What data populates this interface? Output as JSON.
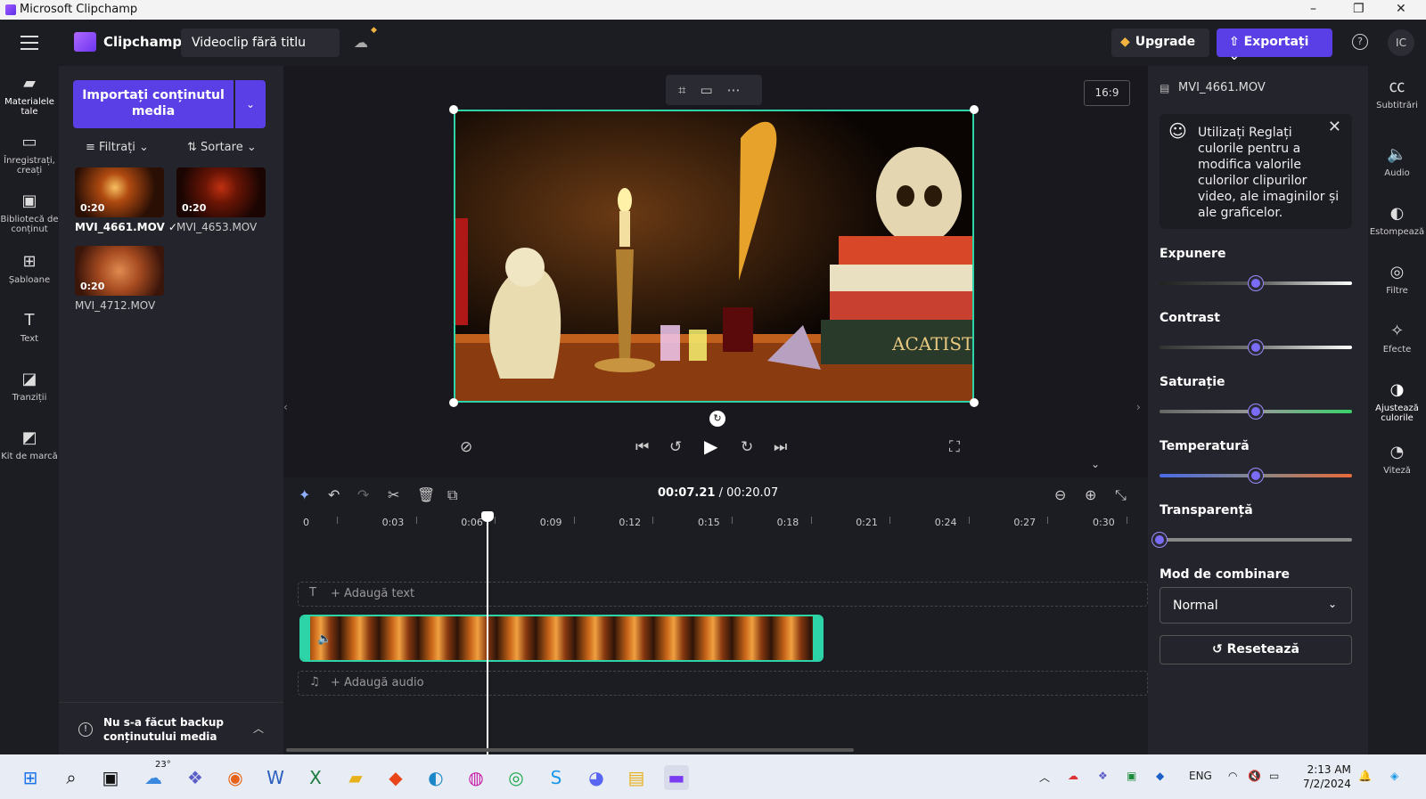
{
  "window": {
    "title": "Microsoft Clipchamp",
    "min": "–",
    "max": "❐",
    "close": "✕"
  },
  "header": {
    "app_name": "Clipchamp",
    "project_title": "Videoclip fără titlu",
    "upgrade_label": "Upgrade",
    "export_label": "Exportați",
    "help": "?",
    "avatar_initials": "IC"
  },
  "leftnav": [
    {
      "label": "Materialele tale",
      "icon": "folder-icon"
    },
    {
      "label": "Înregistrați, creați",
      "icon": "camera-icon"
    },
    {
      "label": "Bibliotecă de conținut",
      "icon": "library-icon"
    },
    {
      "label": "Șabloane",
      "icon": "templates-icon"
    },
    {
      "label": "Text",
      "icon": "text-icon"
    },
    {
      "label": "Tranziții",
      "icon": "transitions-icon"
    },
    {
      "label": "Kit de marcă",
      "icon": "brand-kit-icon"
    }
  ],
  "media": {
    "import_label": "Importați conținutul media",
    "filter_label": "Filtrați",
    "sort_label": "Sortare",
    "items": [
      {
        "name": "MVI_4661.MOV ✓",
        "duration": "0:20"
      },
      {
        "name": "MVI_4653.MOV",
        "duration": "0:20"
      },
      {
        "name": "MVI_4712.MOV",
        "duration": "0:20"
      }
    ],
    "backup_notice": "Nu s-a făcut backup conținutului media"
  },
  "preview": {
    "aspect_ratio": "16:9"
  },
  "timeline": {
    "current_time": "00:07.21",
    "total_time": "/ 00:20.07",
    "ruler": [
      "0",
      "0:03",
      "0:06",
      "0:09",
      "0:12",
      "0:15",
      "0:18",
      "0:21",
      "0:24",
      "0:27",
      "0:30"
    ],
    "add_text": "+ Adaugă text",
    "add_audio": "+ Adaugă audio"
  },
  "props": {
    "file_name": "MVI_4661.MOV",
    "tip": "Utilizați Reglați culorile pentru a modifica valorile culorilor clipurilor video, ale imaginilor și ale graficelor.",
    "sliders": [
      {
        "label": "Expunere",
        "value": 0.5
      },
      {
        "label": "Contrast",
        "value": 0.5
      },
      {
        "label": "Saturație",
        "value": 0.5
      },
      {
        "label": "Temperatură",
        "value": 0.5
      },
      {
        "label": "Transparență",
        "value": 0.0
      }
    ],
    "blend_label": "Mod de combinare",
    "blend_value": "Normal",
    "reset_label": "Resetează"
  },
  "rightnav": [
    {
      "label": "Subtitrări",
      "icon": "captions-icon"
    },
    {
      "label": "Audio",
      "icon": "audio-icon"
    },
    {
      "label": "Estompează",
      "icon": "fade-icon"
    },
    {
      "label": "Filtre",
      "icon": "filters-icon"
    },
    {
      "label": "Efecte",
      "icon": "effects-icon"
    },
    {
      "label": "Ajustează culorile",
      "icon": "adjust-colors-icon"
    },
    {
      "label": "Viteză",
      "icon": "speed-icon"
    }
  ],
  "taskbar": {
    "weather": "23°",
    "lang": "ENG",
    "time": "2:13 AM",
    "date": "7/2/2024"
  }
}
